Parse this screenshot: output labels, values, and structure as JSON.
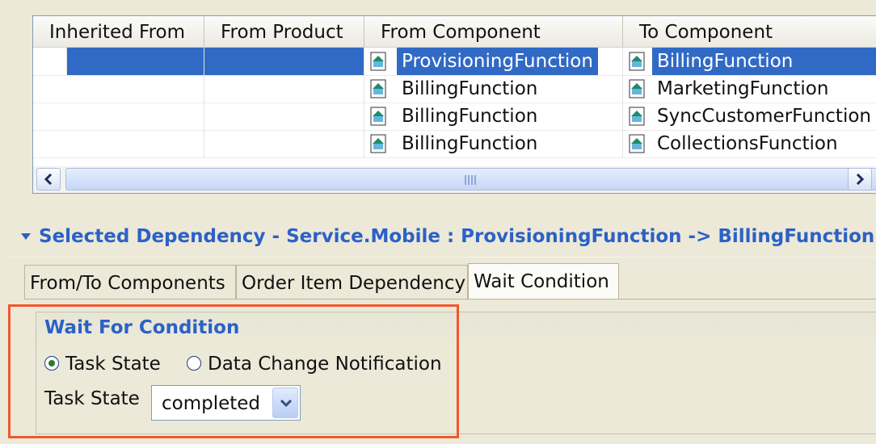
{
  "table": {
    "columns": [
      "Inherited From",
      "From Product",
      "From Component",
      "To Component"
    ],
    "rows": [
      {
        "inherited_from": "",
        "from_product": "",
        "from_component": "ProvisioningFunction",
        "to_component": "BillingFunction",
        "selected": true
      },
      {
        "inherited_from": "",
        "from_product": "",
        "from_component": "BillingFunction",
        "to_component": "MarketingFunction",
        "selected": false
      },
      {
        "inherited_from": "",
        "from_product": "",
        "from_component": "BillingFunction",
        "to_component": "SyncCustomerFunction",
        "selected": false
      },
      {
        "inherited_from": "",
        "from_product": "",
        "from_component": "BillingFunction",
        "to_component": "CollectionsFunction",
        "selected": false
      }
    ],
    "scroll_left_icon": "chevron-left-icon",
    "scroll_right_icon": "chevron-right-icon",
    "component_icon": "component-icon"
  },
  "section": {
    "title": "Selected Dependency - Service.Mobile : ProvisioningFunction -> BillingFunction",
    "toggle_icon": "triangle-down-icon"
  },
  "tabs": [
    {
      "label": "From/To Components",
      "active": false
    },
    {
      "label": "Order Item Dependency",
      "active": false
    },
    {
      "label": "Wait Condition",
      "active": true
    }
  ],
  "wait": {
    "group_title": "Wait For Condition",
    "radio_task_state": "Task State",
    "radio_data_change": "Data Change Notification",
    "selected_radio": "Task State",
    "field_label": "Task State",
    "select_value": "completed"
  },
  "colors": {
    "accent": "#2b61c7",
    "selection": "#316ac5",
    "highlight_border": "#f2572e",
    "background": "#ece9d8"
  }
}
